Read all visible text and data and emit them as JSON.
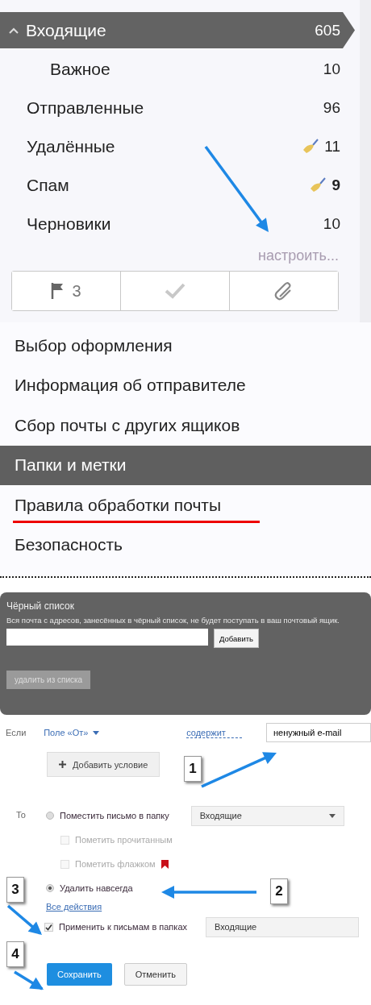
{
  "folders": {
    "items": [
      {
        "name": "Входящие",
        "count": "605",
        "selected": true,
        "expanded": true,
        "children": [
          {
            "name": "Важное",
            "count": "10",
            "selected": false
          }
        ]
      },
      {
        "name": "Отправленные",
        "count": "96",
        "selected": false,
        "clean": false,
        "unread": false
      },
      {
        "name": "Удалённые",
        "count": "11",
        "selected": false,
        "clean": true,
        "unread": false
      },
      {
        "name": "Спам",
        "count": "9",
        "selected": false,
        "clean": true,
        "unread": true
      },
      {
        "name": "Черновики",
        "count": "10",
        "selected": false,
        "clean": false,
        "unread": false
      }
    ],
    "setup_link": "настроить...",
    "filters": [
      {
        "kind": "flag",
        "count": "3"
      },
      {
        "kind": "check"
      },
      {
        "kind": "attachment"
      }
    ]
  },
  "settings_menu": [
    {
      "label": "Выбор оформления",
      "selected": false,
      "underlined": false
    },
    {
      "label": "Информация об отправителе",
      "selected": false,
      "underlined": false
    },
    {
      "label": "Сбор почты с других ящиков",
      "selected": false,
      "underlined": false
    },
    {
      "label": "Папки и метки",
      "selected": true,
      "underlined": false
    },
    {
      "label": "Правила обработки почты",
      "selected": false,
      "underlined": true
    },
    {
      "label": "Безопасность",
      "selected": false,
      "underlined": false
    }
  ],
  "blacklist": {
    "title": "Чёрный список",
    "description": "Вся почта с адресов, занесённых в чёрный список, не будет поступать в ваш почтовый ящик.",
    "add_button": "Добавить",
    "remove_button": "удалить из списка"
  },
  "rule": {
    "if_label": "Если",
    "field": "Поле «От»",
    "condition": "содержит",
    "value": "ненужный e-mail",
    "add_condition": "Добавить условие",
    "then_label": "То",
    "actions": [
      {
        "kind": "radio",
        "label": "Поместить письмо в папку",
        "selected": false,
        "folder": "Входящие"
      },
      {
        "kind": "checkbox",
        "label": "Пометить прочитанным",
        "checked": false,
        "disabled": true
      },
      {
        "kind": "checkbox",
        "label": "Пометить флажком",
        "checked": false,
        "disabled": true,
        "flag": true
      },
      {
        "kind": "radio",
        "label": "Удалить навсегда",
        "selected": true
      }
    ],
    "all_actions": "Все действия",
    "apply": {
      "label": "Применить к письмам в папках",
      "checked": true,
      "folder": "Входящие"
    },
    "save": "Сохранить",
    "cancel": "Отменить"
  },
  "callouts": [
    {
      "number": "1"
    },
    {
      "number": "2"
    },
    {
      "number": "3"
    },
    {
      "number": "4"
    }
  ]
}
